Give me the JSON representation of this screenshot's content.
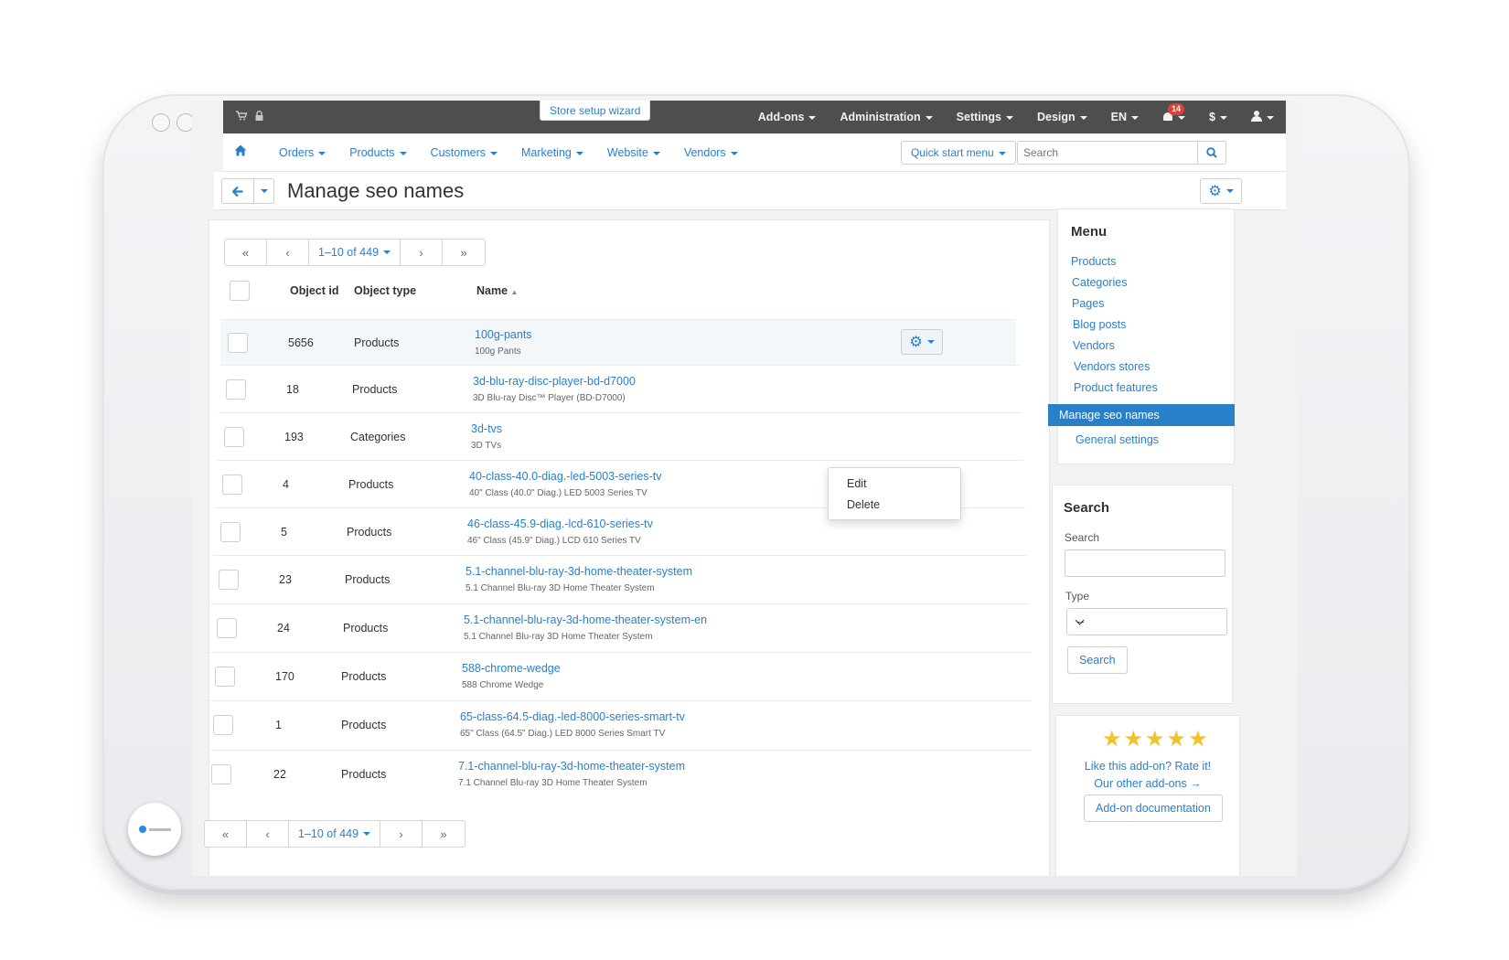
{
  "topbar": {
    "wizard": "Store setup wizard",
    "menu": [
      "Add-ons",
      "Administration",
      "Settings",
      "Design",
      "EN"
    ],
    "notifications": "14",
    "currency": "$"
  },
  "nav": {
    "items": [
      "Orders",
      "Products",
      "Customers",
      "Marketing",
      "Website",
      "Vendors"
    ],
    "quick_start": "Quick start menu",
    "search_placeholder": "Search"
  },
  "page": {
    "title": "Manage seo names"
  },
  "pager": {
    "range": "1–10 of 449",
    "first": "«",
    "prev": "‹",
    "next": "›",
    "last": "»"
  },
  "table": {
    "headers": {
      "object_id": "Object id",
      "object_type": "Object type",
      "name": "Name"
    },
    "rows": [
      {
        "id": "5656",
        "type": "Products",
        "name": "100g-pants",
        "sub": "100g Pants"
      },
      {
        "id": "18",
        "type": "Products",
        "name": "3d-blu-ray-disc-player-bd-d7000",
        "sub": "3D Blu-ray Disc™ Player (BD-D7000)"
      },
      {
        "id": "193",
        "type": "Categories",
        "name": "3d-tvs",
        "sub": "3D TVs"
      },
      {
        "id": "4",
        "type": "Products",
        "name": "40-class-40.0-diag.-led-5003-series-tv",
        "sub": "40\" Class (40.0\" Diag.) LED 5003 Series TV"
      },
      {
        "id": "5",
        "type": "Products",
        "name": "46-class-45.9-diag.-lcd-610-series-tv",
        "sub": "46\" Class (45.9\" Diag.) LCD 610 Series TV"
      },
      {
        "id": "23",
        "type": "Products",
        "name": "5.1-channel-blu-ray-3d-home-theater-system",
        "sub": "5.1 Channel Blu-ray 3D Home Theater System"
      },
      {
        "id": "24",
        "type": "Products",
        "name": "5.1-channel-blu-ray-3d-home-theater-system-en",
        "sub": "5.1 Channel Blu-ray 3D Home Theater System"
      },
      {
        "id": "170",
        "type": "Products",
        "name": "588-chrome-wedge",
        "sub": "588 Chrome Wedge"
      },
      {
        "id": "1",
        "type": "Products",
        "name": "65-class-64.5-diag.-led-8000-series-smart-tv",
        "sub": "65\" Class (64.5\" Diag.) LED 8000 Series Smart TV"
      },
      {
        "id": "22",
        "type": "Products",
        "name": "7.1-channel-blu-ray-3d-home-theater-system",
        "sub": "7.1 Channel Blu-ray 3D Home Theater System"
      }
    ]
  },
  "context_menu": {
    "edit": "Edit",
    "delete": "Delete"
  },
  "sidebar": {
    "menu_title": "Menu",
    "items": [
      "Products",
      "Categories",
      "Pages",
      "Blog posts",
      "Vendors",
      "Vendors stores",
      "Product features"
    ],
    "active": "Manage seo names",
    "general": "General settings",
    "search_title": "Search",
    "search_label": "Search",
    "type_label": "Type",
    "type_value": "--",
    "search_button": "Search",
    "rate": "Like this add-on? Rate it!",
    "other": "Our other add-ons →",
    "docs": "Add-on documentation"
  },
  "colors": {
    "accent": "#2a7fc9",
    "topbar": "#4e4e4e",
    "badge": "#d9413a",
    "stars": "#f3c12b"
  }
}
